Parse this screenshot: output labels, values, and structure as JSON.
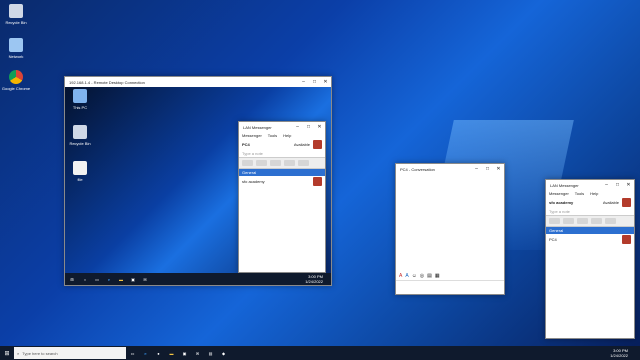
{
  "desktop_icons": [
    {
      "label": "Recycle Bin",
      "icon": "recycle-bin-icon"
    },
    {
      "label": "Network",
      "icon": "network-icon"
    },
    {
      "label": "Google Chrome",
      "icon": "chrome-icon"
    }
  ],
  "rdc": {
    "title": "192.168.1.4 - Remote Desktop Connection",
    "icons": [
      {
        "label": "This PC",
        "icon": "pc-icon"
      },
      {
        "label": "Recycle Bin",
        "icon": "recycle-bin-icon"
      },
      {
        "label": "file",
        "icon": "file-icon"
      }
    ],
    "clock_time": "3:00 PM",
    "clock_date": "1/24/2022"
  },
  "lan_remote": {
    "title": "LAN Messenger",
    "menu": [
      "Messenger",
      "Tools",
      "Help"
    ],
    "user": "PC4",
    "status": "Available",
    "note": "Type a note",
    "group": "General",
    "contact": "sfo academy"
  },
  "conversation": {
    "title": "PC4 - Conversation"
  },
  "lan_local": {
    "title": "LAN Messenger",
    "menu": [
      "Messenger",
      "Tools",
      "Help"
    ],
    "user": "sfo academy",
    "status": "Available",
    "note": "Type a note",
    "group": "General",
    "contact": "PC4"
  },
  "taskbar": {
    "search_placeholder": "Type here to search",
    "time": "3:00 PM",
    "date": "1/24/2022"
  }
}
